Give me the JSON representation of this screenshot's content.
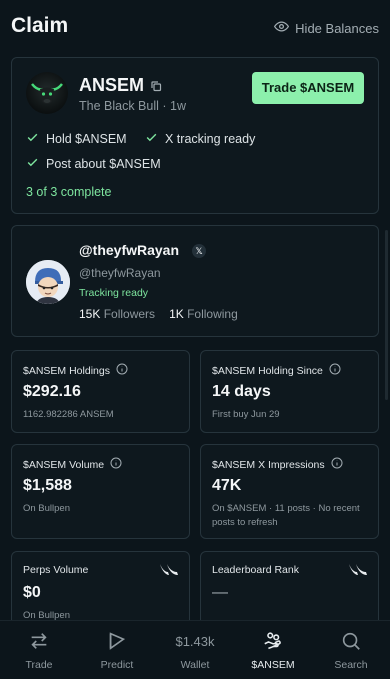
{
  "header": {
    "title": "Claim",
    "hide_balances_label": "Hide Balances"
  },
  "token": {
    "name": "ANSEM",
    "subtitle": "The Black Bull · 1w",
    "trade_label": "Trade $ANSEM",
    "checks": [
      "Hold $ANSEM",
      "X tracking ready",
      "Post about $ANSEM"
    ],
    "progress_text": "3 of 3 complete"
  },
  "profile": {
    "display_handle": "@theyfwRayan",
    "x_badge": "𝕏",
    "handle": "@theyfwRayan",
    "status": "Tracking ready",
    "followers_count": "15K",
    "followers_label": "Followers",
    "following_count": "1K",
    "following_label": "Following"
  },
  "tiles": [
    {
      "label": "$ANSEM Holdings",
      "value": "$292.16",
      "sub": "1162.982286 ANSEM"
    },
    {
      "label": "$ANSEM Holding Since",
      "value": "14 days",
      "sub": "First buy Jun 29"
    },
    {
      "label": "$ANSEM Volume",
      "value": "$1,588",
      "sub": "On Bullpen"
    },
    {
      "label": "$ANSEM X Impressions",
      "value": "47K",
      "sub": "On $ANSEM · 11 posts · No recent posts to refresh"
    },
    {
      "label": "Perps Volume",
      "value": "$0",
      "sub": "On Bullpen"
    },
    {
      "label": "Leaderboard Rank",
      "value": "—",
      "sub": ""
    }
  ],
  "nav": {
    "trade": "Trade",
    "predict": "Predict",
    "wallet_amount": "$1.43k",
    "wallet": "Wallet",
    "ansem": "$ANSEM",
    "search": "Search"
  },
  "colors": {
    "accent": "#8cf0ac",
    "background": "#0c151b",
    "border": "#26343c"
  },
  "icons": {
    "hide": "eye-icon",
    "copy": "copy-icon",
    "check": "check-icon",
    "info": "info-icon",
    "brand": "bullpen-horns-icon"
  }
}
